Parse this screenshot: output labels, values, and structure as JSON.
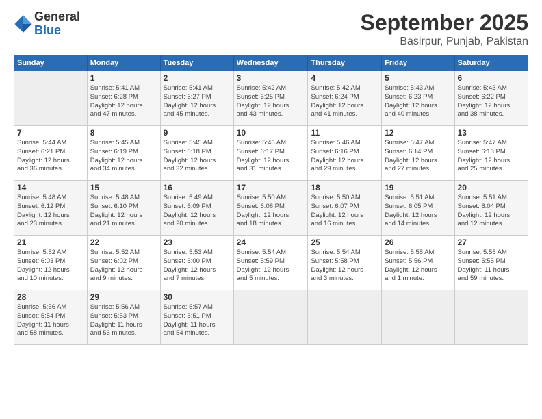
{
  "logo": {
    "general": "General",
    "blue": "Blue"
  },
  "title": "September 2025",
  "subtitle": "Basirpur, Punjab, Pakistan",
  "days_header": [
    "Sunday",
    "Monday",
    "Tuesday",
    "Wednesday",
    "Thursday",
    "Friday",
    "Saturday"
  ],
  "weeks": [
    [
      {
        "day": "",
        "info": ""
      },
      {
        "day": "1",
        "info": "Sunrise: 5:41 AM\nSunset: 6:28 PM\nDaylight: 12 hours\nand 47 minutes."
      },
      {
        "day": "2",
        "info": "Sunrise: 5:41 AM\nSunset: 6:27 PM\nDaylight: 12 hours\nand 45 minutes."
      },
      {
        "day": "3",
        "info": "Sunrise: 5:42 AM\nSunset: 6:25 PM\nDaylight: 12 hours\nand 43 minutes."
      },
      {
        "day": "4",
        "info": "Sunrise: 5:42 AM\nSunset: 6:24 PM\nDaylight: 12 hours\nand 41 minutes."
      },
      {
        "day": "5",
        "info": "Sunrise: 5:43 AM\nSunset: 6:23 PM\nDaylight: 12 hours\nand 40 minutes."
      },
      {
        "day": "6",
        "info": "Sunrise: 5:43 AM\nSunset: 6:22 PM\nDaylight: 12 hours\nand 38 minutes."
      }
    ],
    [
      {
        "day": "7",
        "info": "Sunrise: 5:44 AM\nSunset: 6:21 PM\nDaylight: 12 hours\nand 36 minutes."
      },
      {
        "day": "8",
        "info": "Sunrise: 5:45 AM\nSunset: 6:19 PM\nDaylight: 12 hours\nand 34 minutes."
      },
      {
        "day": "9",
        "info": "Sunrise: 5:45 AM\nSunset: 6:18 PM\nDaylight: 12 hours\nand 32 minutes."
      },
      {
        "day": "10",
        "info": "Sunrise: 5:46 AM\nSunset: 6:17 PM\nDaylight: 12 hours\nand 31 minutes."
      },
      {
        "day": "11",
        "info": "Sunrise: 5:46 AM\nSunset: 6:16 PM\nDaylight: 12 hours\nand 29 minutes."
      },
      {
        "day": "12",
        "info": "Sunrise: 5:47 AM\nSunset: 6:14 PM\nDaylight: 12 hours\nand 27 minutes."
      },
      {
        "day": "13",
        "info": "Sunrise: 5:47 AM\nSunset: 6:13 PM\nDaylight: 12 hours\nand 25 minutes."
      }
    ],
    [
      {
        "day": "14",
        "info": "Sunrise: 5:48 AM\nSunset: 6:12 PM\nDaylight: 12 hours\nand 23 minutes."
      },
      {
        "day": "15",
        "info": "Sunrise: 5:48 AM\nSunset: 6:10 PM\nDaylight: 12 hours\nand 21 minutes."
      },
      {
        "day": "16",
        "info": "Sunrise: 5:49 AM\nSunset: 6:09 PM\nDaylight: 12 hours\nand 20 minutes."
      },
      {
        "day": "17",
        "info": "Sunrise: 5:50 AM\nSunset: 6:08 PM\nDaylight: 12 hours\nand 18 minutes."
      },
      {
        "day": "18",
        "info": "Sunrise: 5:50 AM\nSunset: 6:07 PM\nDaylight: 12 hours\nand 16 minutes."
      },
      {
        "day": "19",
        "info": "Sunrise: 5:51 AM\nSunset: 6:05 PM\nDaylight: 12 hours\nand 14 minutes."
      },
      {
        "day": "20",
        "info": "Sunrise: 5:51 AM\nSunset: 6:04 PM\nDaylight: 12 hours\nand 12 minutes."
      }
    ],
    [
      {
        "day": "21",
        "info": "Sunrise: 5:52 AM\nSunset: 6:03 PM\nDaylight: 12 hours\nand 10 minutes."
      },
      {
        "day": "22",
        "info": "Sunrise: 5:52 AM\nSunset: 6:02 PM\nDaylight: 12 hours\nand 9 minutes."
      },
      {
        "day": "23",
        "info": "Sunrise: 5:53 AM\nSunset: 6:00 PM\nDaylight: 12 hours\nand 7 minutes."
      },
      {
        "day": "24",
        "info": "Sunrise: 5:54 AM\nSunset: 5:59 PM\nDaylight: 12 hours\nand 5 minutes."
      },
      {
        "day": "25",
        "info": "Sunrise: 5:54 AM\nSunset: 5:58 PM\nDaylight: 12 hours\nand 3 minutes."
      },
      {
        "day": "26",
        "info": "Sunrise: 5:55 AM\nSunset: 5:56 PM\nDaylight: 12 hours\nand 1 minute."
      },
      {
        "day": "27",
        "info": "Sunrise: 5:55 AM\nSunset: 5:55 PM\nDaylight: 11 hours\nand 59 minutes."
      }
    ],
    [
      {
        "day": "28",
        "info": "Sunrise: 5:56 AM\nSunset: 5:54 PM\nDaylight: 11 hours\nand 58 minutes."
      },
      {
        "day": "29",
        "info": "Sunrise: 5:56 AM\nSunset: 5:53 PM\nDaylight: 11 hours\nand 56 minutes."
      },
      {
        "day": "30",
        "info": "Sunrise: 5:57 AM\nSunset: 5:51 PM\nDaylight: 11 hours\nand 54 minutes."
      },
      {
        "day": "",
        "info": ""
      },
      {
        "day": "",
        "info": ""
      },
      {
        "day": "",
        "info": ""
      },
      {
        "day": "",
        "info": ""
      }
    ]
  ]
}
